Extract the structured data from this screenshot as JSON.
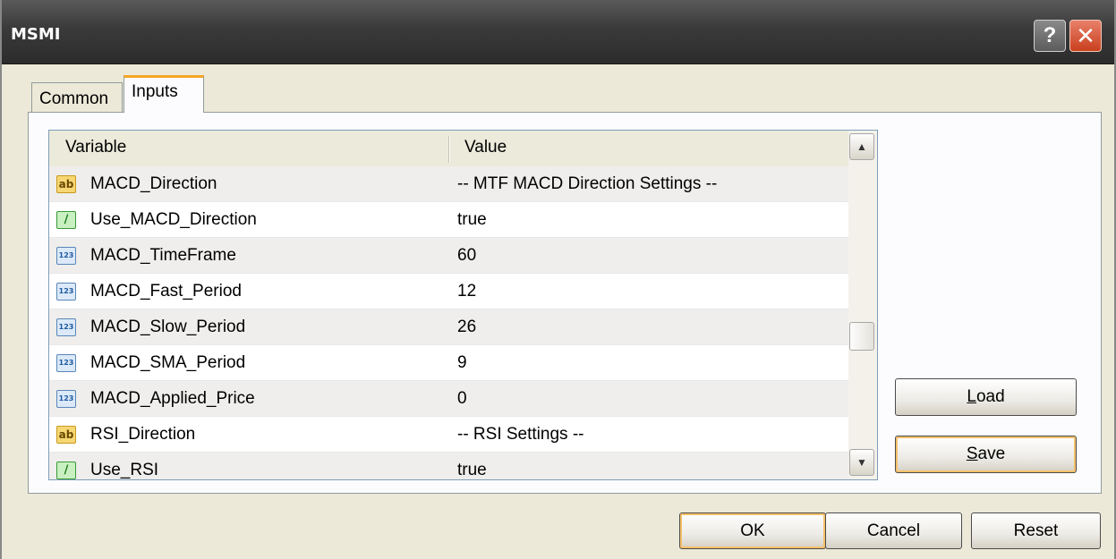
{
  "window": {
    "title": "MSMI"
  },
  "tabs": [
    {
      "label": "Common",
      "active": false
    },
    {
      "label": "Inputs",
      "active": true
    }
  ],
  "grid": {
    "columns": [
      "Variable",
      "Value"
    ],
    "rows": [
      {
        "icon": "string-ab-icon",
        "icon_text": "ab",
        "variable": "MACD_Direction",
        "value": "-- MTF MACD Direction Settings --"
      },
      {
        "icon": "boolean-icon",
        "icon_text": "∕",
        "variable": "Use_MACD_Direction",
        "value": "true"
      },
      {
        "icon": "integer-123-icon",
        "icon_text": "123",
        "variable": "MACD_TimeFrame",
        "value": "60"
      },
      {
        "icon": "integer-123-icon",
        "icon_text": "123",
        "variable": "MACD_Fast_Period",
        "value": "12"
      },
      {
        "icon": "integer-123-icon",
        "icon_text": "123",
        "variable": "MACD_Slow_Period",
        "value": "26"
      },
      {
        "icon": "integer-123-icon",
        "icon_text": "123",
        "variable": "MACD_SMA_Period",
        "value": "9"
      },
      {
        "icon": "integer-123-icon",
        "icon_text": "123",
        "variable": "MACD_Applied_Price",
        "value": "0"
      },
      {
        "icon": "string-ab-icon",
        "icon_text": "ab",
        "variable": "RSI_Direction",
        "value": "-- RSI Settings --"
      },
      {
        "icon": "boolean-icon",
        "icon_text": "∕",
        "variable": "Use_RSI",
        "value": "true"
      }
    ]
  },
  "buttons": {
    "load": {
      "mnemonic": "L",
      "rest": "oad"
    },
    "save": {
      "mnemonic": "S",
      "rest": "ave"
    },
    "ok": "OK",
    "cancel": "Cancel",
    "reset": "Reset"
  },
  "icons": {
    "help": "?",
    "close": "✕",
    "scroll_up": "▲",
    "scroll_down": "▼"
  },
  "colors": {
    "titlebar": "#3a3a3a",
    "window_bg": "#ece9d8",
    "active_tab_accent": "#f5a623",
    "close_button": "#c9401e"
  }
}
